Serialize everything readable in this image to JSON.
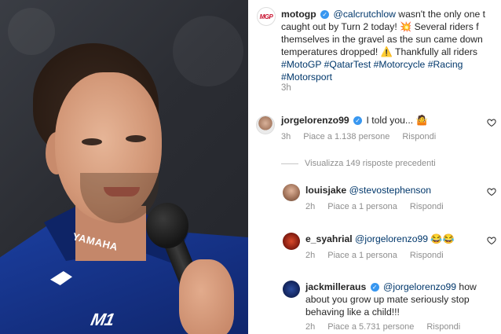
{
  "post": {
    "username": "motogp",
    "avatar_text": "MGP",
    "caption_lines": [
      {
        "mention": "@calcrutchlow",
        "text": " wasn't the only one t"
      },
      {
        "text": "caught out by Turn 2 today! 💥 Several riders f"
      },
      {
        "text": "themselves in the gravel as the sun came down"
      },
      {
        "text": "temperatures dropped! ⚠️ Thankfully all riders"
      }
    ],
    "hashtags_line1": "#MotoGP #QatarTest #Motorcycle #Racing",
    "hashtags_line2": "#Motorsport",
    "time": "3h"
  },
  "comments": [
    {
      "username": "jorgelorenzo99",
      "verified": true,
      "text": "I told you... 🤷",
      "time": "3h",
      "likes": "Piace a 1.138 persone",
      "reply": "Rispondi"
    }
  ],
  "view_replies": "Visualizza 149 risposte precedenti",
  "replies": [
    {
      "username": "louisjake",
      "mention": "@stevostephenson",
      "text": "",
      "time": "2h",
      "likes": "Piace a 1 persona",
      "reply": "Rispondi"
    },
    {
      "username": "e_syahrial",
      "mention": "@jorgelorenzo99",
      "text": " 😂😂",
      "time": "2h",
      "likes": "Piace a 1 persona",
      "reply": "Rispondi"
    },
    {
      "username": "jackmilleraus",
      "verified": true,
      "mention": "@jorgelorenzo99",
      "text_line1": " how",
      "text_line2": "about you grow up mate seriously stop",
      "text_line3": "behaving like a child!!!",
      "time": "2h",
      "likes": "Piace a 5.731 persone",
      "reply": "Rispondi"
    }
  ],
  "photo": {
    "shirt_logo": "YAMAHA",
    "shirt_mark": "M1"
  },
  "colors": {
    "link": "#00376b",
    "meta": "#8e8e8e",
    "verified": "#3897f0",
    "motogp_red": "#c8102e",
    "shirt_blue": "#1b3fa0"
  },
  "icons": [
    "verified-icon",
    "heart-icon"
  ]
}
